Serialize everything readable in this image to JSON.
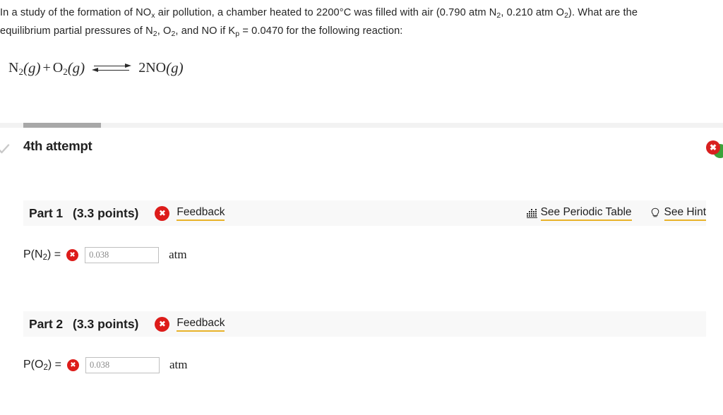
{
  "question": {
    "line1_a": "In a study of the formation of NO",
    "line1_sub": "x",
    "line1_b": " air pollution, a chamber heated to 2200°C was filled with air (0.790 atm N",
    "line1_sub2": "2",
    "line1_c": ", 0.210 atm O",
    "line1_sub3": "2",
    "line1_d": "). What are the",
    "line2_a": "equilibrium partial pressures of N",
    "line2_sub1": "2",
    "line2_b": ", O",
    "line2_sub2": "2",
    "line2_c": ", and NO if K",
    "line2_sub3": "p",
    "line2_d": " = 0.0470  for the following reaction:"
  },
  "equation": {
    "reactant1": "N",
    "reactant1_sub": "2",
    "reactant1_state": "(g)",
    "plus": "+",
    "reactant2": "O",
    "reactant2_sub": "2",
    "reactant2_state": "(g)",
    "arrow": "equilibrium-double-arrow",
    "product_coeff": "2",
    "product": "NO",
    "product_state": "(g)"
  },
  "attempt": {
    "label": "4th attempt",
    "check_icon": "check-icon",
    "progress_percent": 11,
    "edge_badge_error": "✖",
    "edge_badge_error_color": "#d8201f",
    "edge_badge_success_color": "#3aa33a"
  },
  "tools": {
    "periodic_table_label": "See Periodic Table",
    "periodic_table_icon": "periodic-table-icon",
    "hint_label": "See Hint",
    "hint_icon": "lightbulb-icon",
    "underline_color": "#e8b32a"
  },
  "parts": [
    {
      "title": "Part 1",
      "points": "(3.3 points)",
      "status_icon": "✖",
      "status_color": "#dd1c1a",
      "feedback_label": "Feedback",
      "answer_label_pre": "P(N",
      "answer_label_sub": "2",
      "answer_label_post": ") =",
      "input_value": "0.038",
      "input_placeholder": "0.038",
      "unit": "atm"
    },
    {
      "title": "Part 2",
      "points": "(3.3 points)",
      "status_icon": "✖",
      "status_color": "#dd1c1a",
      "feedback_label": "Feedback",
      "answer_label_pre": "P(O",
      "answer_label_sub": "2",
      "answer_label_post": ") =",
      "input_value": "0.038",
      "input_placeholder": "0.038",
      "unit": "atm"
    }
  ]
}
